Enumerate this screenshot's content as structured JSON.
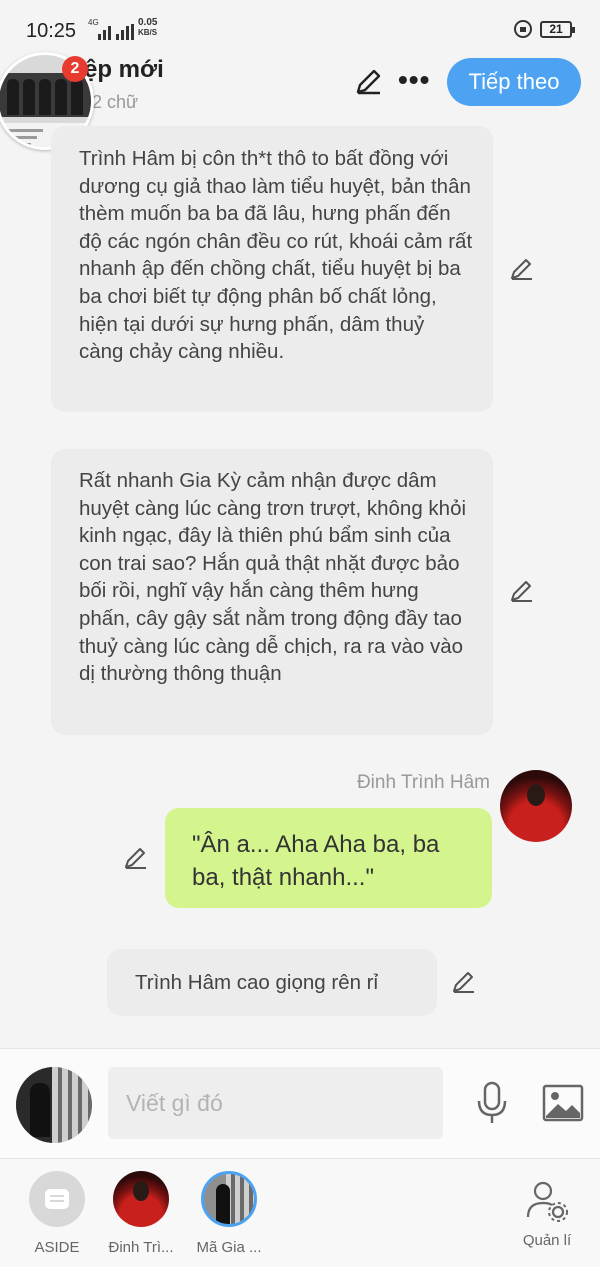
{
  "status_bar": {
    "time": "10:25",
    "network": "4G",
    "speed_value": "0.05",
    "speed_unit": "KB/S",
    "battery": "21"
  },
  "header": {
    "title": "ệp mới",
    "word_count": "2 chữ",
    "next_label": "Tiếp theo",
    "more": "•••",
    "notification_count": "2"
  },
  "messages": {
    "narration_1": "Trình Hâm bị côn th*t thô to bất đồng với dương cụ giả thao làm tiểu huyệt, bản thân thèm muốn ba ba đã lâu, hưng phấn đến độ các ngón chân đều co rút, khoái cảm rất nhanh ập đến chồng chất, tiểu huyệt bị ba ba chơi biết tự động phân bố chất lỏng, hiện tại dưới sự hưng phấn, dâm thuỷ càng chảy càng nhiều.",
    "narration_2": "Rất nhanh Gia Kỳ cảm nhận được dâm huyệt càng lúc càng trơn trượt, không khỏi kinh ngạc, đây là thiên phú bẩm sinh của con trai sao? Hắn quả thật nhặt được bảo bối rồi, nghĩ vậy hắn càng thêm hưng phấn, cây gậy sắt nằm trong động đầy tao thuỷ càng lúc càng dễ chịch, ra ra vào vào dị thường thông thuận",
    "sender_name": "Đinh Trình Hâm",
    "dialogue": "\"Ân a... Aha Aha ba, ba ba, thật nhanh...\"",
    "narration_3": "Trình Hâm cao giọng rên rỉ"
  },
  "composer": {
    "placeholder": "Viết gì đó"
  },
  "bottom_bar": [
    {
      "label": "ASIDE"
    },
    {
      "label": "Đinh Trì..."
    },
    {
      "label": "Mã Gia ..."
    },
    {
      "label": "Quản lí"
    }
  ],
  "colors": {
    "accent": "#4da3f2",
    "dialogue_bubble": "#d4f48e",
    "narration_bubble": "#ececec",
    "badge": "#e63b2e"
  }
}
